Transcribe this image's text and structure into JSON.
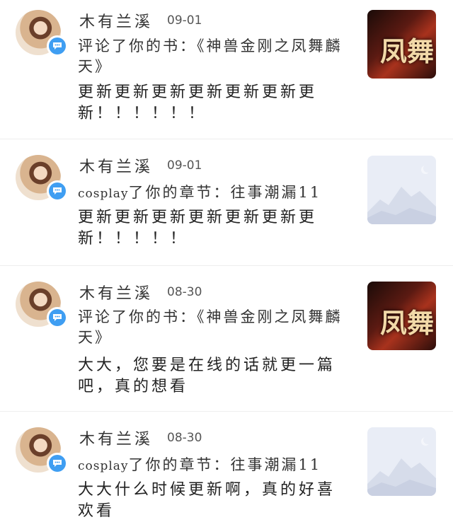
{
  "items": [
    {
      "user": "木有兰溪",
      "date": "09-01",
      "action": "评论了你的书：《神兽金刚之凤舞麟天》",
      "content": "更新更新更新更新更新更新更新！！！！！！",
      "thumb": "book-cover"
    },
    {
      "user": "木有兰溪",
      "date": "09-01",
      "action_prefix": "cosplay",
      "action": "了你的章节：往事潮漏11",
      "content": "更新更新更新更新更新更新更新！！！！！",
      "thumb": "placeholder-image"
    },
    {
      "user": "木有兰溪",
      "date": "08-30",
      "action": "评论了你的书：《神兽金刚之凤舞麟天》",
      "content": "大大，您要是在线的话就更一篇吧，真的想看",
      "thumb": "book-cover"
    },
    {
      "user": "木有兰溪",
      "date": "08-30",
      "action_prefix": "cosplay",
      "action": "了你的章节：往事潮漏11",
      "content": "大大什么时候更新啊，真的好喜欢看",
      "thumb": "placeholder-image"
    }
  ],
  "cover_text": "凤舞",
  "colors": {
    "badge": "#3f9ef2",
    "divider": "#eeeeee"
  }
}
